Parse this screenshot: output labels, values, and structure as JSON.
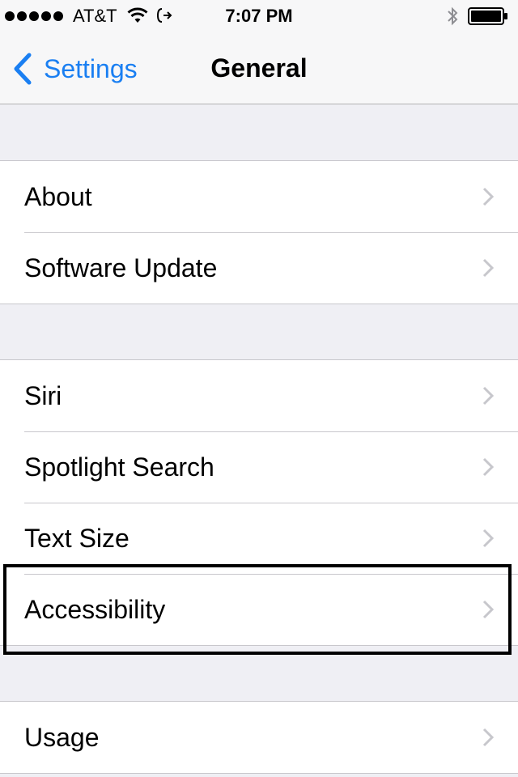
{
  "status_bar": {
    "carrier": "AT&T",
    "time": "7:07 PM",
    "icons": [
      "signal-dots",
      "wifi-icon",
      "call-forwarding-icon",
      "bluetooth-icon",
      "battery-icon"
    ]
  },
  "nav": {
    "back_label": "Settings",
    "title": "General"
  },
  "groups": [
    {
      "rows": [
        "About",
        "Software Update"
      ]
    },
    {
      "rows": [
        "Siri",
        "Spotlight Search",
        "Text Size",
        "Accessibility"
      ]
    },
    {
      "rows": [
        "Usage"
      ]
    }
  ],
  "highlighted_row": "Accessibility",
  "colors": {
    "accent": "#1a7ff2",
    "background": "#efeff4",
    "separator": "#c8c7cc",
    "chevron": "#c7c7cc"
  }
}
